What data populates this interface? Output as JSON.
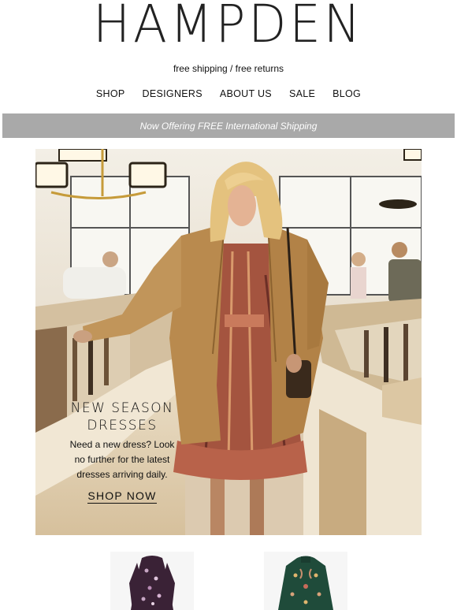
{
  "brand": {
    "logo_text": "HAMPDEN"
  },
  "tagline": "free shipping / free returns",
  "nav": {
    "items": [
      {
        "label": "SHOP"
      },
      {
        "label": "DESIGNERS"
      },
      {
        "label": "ABOUT US"
      },
      {
        "label": "SALE"
      },
      {
        "label": "BLOG"
      }
    ]
  },
  "banner": {
    "text": "Now Offering FREE International Shipping"
  },
  "hero": {
    "title_line1": "NEW SEASON",
    "title_line2": "DRESSES",
    "body_line1": "Need a new dress? Look",
    "body_line2": "no further for the latest",
    "body_line3": "dresses arriving daily.",
    "cta": "SHOP NOW"
  },
  "colors": {
    "banner_bg": "#a9a9a9",
    "text": "#111111",
    "coat": "#b98a4e",
    "dress": "#a4543f"
  }
}
